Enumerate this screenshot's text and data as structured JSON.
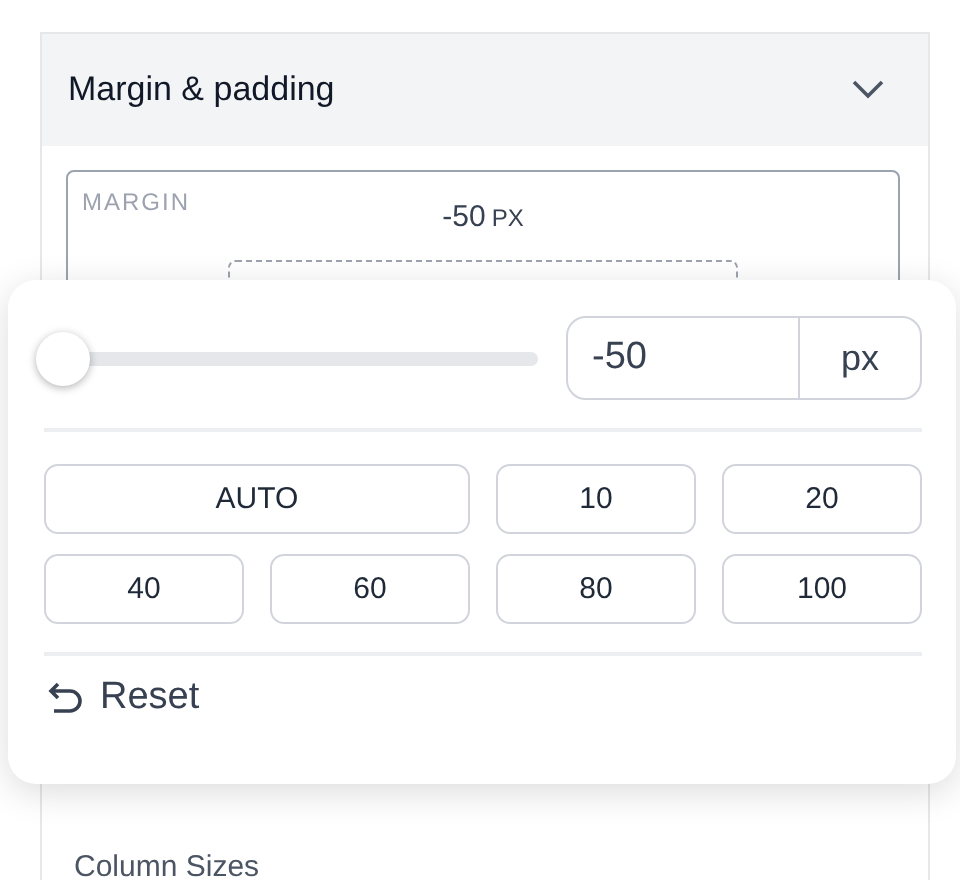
{
  "section": {
    "title": "Margin & padding",
    "expanded": true
  },
  "margin_box": {
    "label": "MARGIN",
    "value": "-50",
    "unit": "PX"
  },
  "popover": {
    "slider": {
      "level": 0.02
    },
    "input": {
      "value": "-50",
      "unit": "px"
    },
    "presets": [
      {
        "label": "AUTO",
        "kind": "wide"
      },
      {
        "label": "10",
        "kind": "normal"
      },
      {
        "label": "20",
        "kind": "normal"
      },
      {
        "label": "40",
        "kind": "normal"
      },
      {
        "label": "60",
        "kind": "normal"
      },
      {
        "label": "80",
        "kind": "normal"
      },
      {
        "label": "100",
        "kind": "normal"
      }
    ],
    "reset": "Reset"
  },
  "next_section": {
    "title": "Column Sizes"
  }
}
